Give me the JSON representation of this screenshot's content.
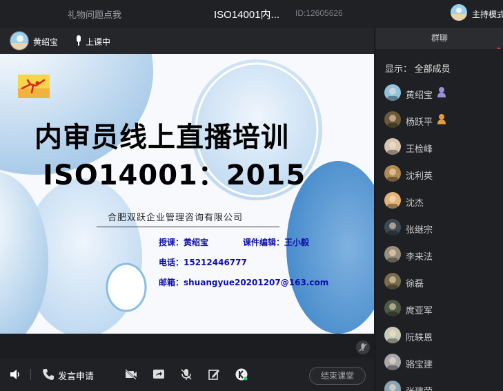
{
  "topbar": {
    "gift_hint": "礼物问题点我",
    "title": "ISO14001内...",
    "room_id": "ID:12605626",
    "host_mode": "主持模式"
  },
  "video": {
    "presenter_name": "黄绍宝",
    "status": "上课中"
  },
  "slide": {
    "title_line1": "内审员线上直播培训",
    "title_line2": "ISO14001：2015",
    "company": "合肥双跃企业管理咨询有限公司",
    "teacher": "授课：黄绍宝",
    "editor": "课件编辑：王小毅",
    "phone": "电话：15212446777",
    "email": "邮箱：shuangyue20201207@163.com"
  },
  "toolbar": {
    "apply_speak": "发言申请",
    "end_class": "结束课堂"
  },
  "chat_panel": {
    "tab_label": "群聊",
    "show_label": "显示：",
    "show_value": "全部成员",
    "members": [
      {
        "name": "黄绍宝",
        "avatar_color": "#8fc4e0",
        "badge": "host-badge-icon",
        "badge_color": "#9b8fd9"
      },
      {
        "name": "杨跃平",
        "avatar_color": "#6d5a3a",
        "badge": "assistant-badge-icon",
        "badge_color": "#e59a3a"
      },
      {
        "name": "王检峰",
        "avatar_color": "#d8c7b0",
        "badge": ""
      },
      {
        "name": "沈利英",
        "avatar_color": "#b08a52",
        "badge": ""
      },
      {
        "name": "沈杰",
        "avatar_color": "#e3b27a",
        "badge": ""
      },
      {
        "name": "张继宗",
        "avatar_color": "#3c4a55",
        "badge": ""
      },
      {
        "name": "李来法",
        "avatar_color": "#9a8f7e",
        "badge": ""
      },
      {
        "name": "徐磊",
        "avatar_color": "#7a6d4e",
        "badge": ""
      },
      {
        "name": "庹亚军",
        "avatar_color": "#4d5a46",
        "badge": ""
      },
      {
        "name": "阮轶恩",
        "avatar_color": "#c9cbb8",
        "badge": ""
      },
      {
        "name": "骆宝建",
        "avatar_color": "#a7a9ad",
        "badge": ""
      },
      {
        "name": "张建荣",
        "avatar_color": "#8aa5b8",
        "badge": ""
      }
    ]
  }
}
